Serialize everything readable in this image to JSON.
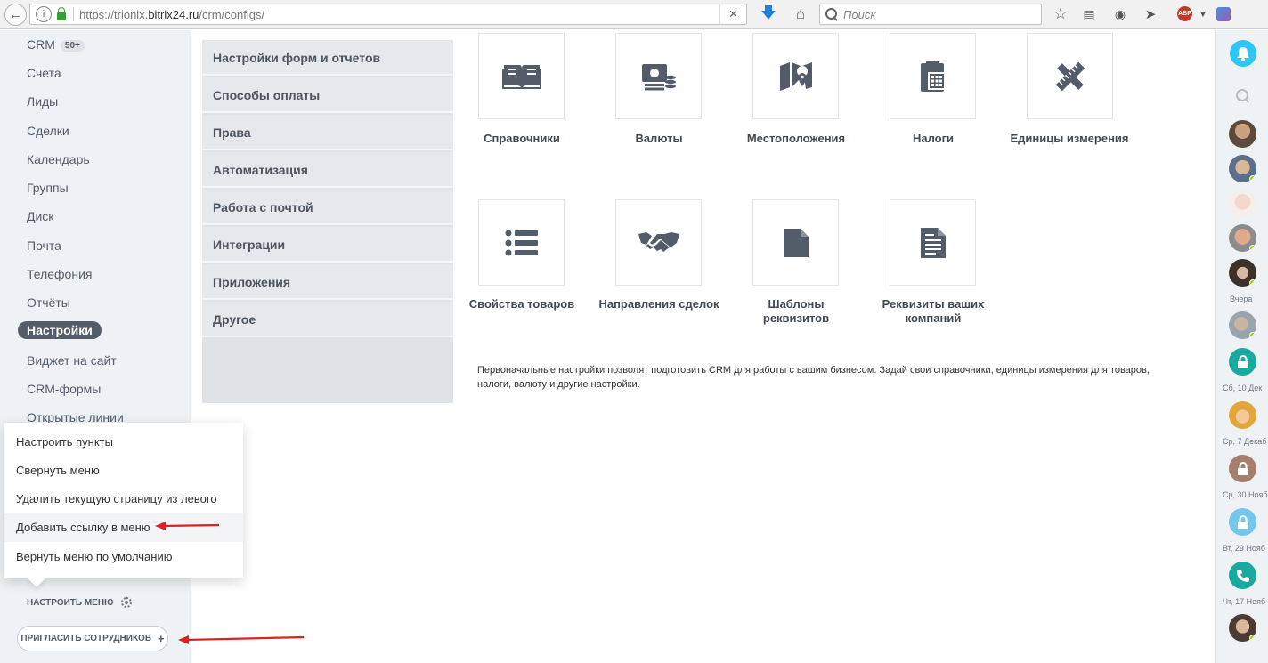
{
  "browser": {
    "url_host": "https://trionix.",
    "url_domain": "bitrix24.ru",
    "url_path": "/crm/configs/",
    "search_placeholder": "Поиск",
    "abp_label": "ABP"
  },
  "left_menu": {
    "items": [
      {
        "label": "CRM",
        "badge": "50+"
      },
      {
        "label": "Счета"
      },
      {
        "label": "Лиды"
      },
      {
        "label": "Сделки"
      },
      {
        "label": "Календарь"
      },
      {
        "label": "Группы"
      },
      {
        "label": "Диск"
      },
      {
        "label": "Почта"
      },
      {
        "label": "Телефония"
      },
      {
        "label": "Отчёты"
      },
      {
        "label": "Настройки",
        "active": true
      },
      {
        "label": "Виджет на сайт"
      },
      {
        "label": "CRM-формы"
      },
      {
        "label": "Открытые линии"
      }
    ],
    "configure_menu_label": "НАСТРОИТЬ МЕНЮ",
    "invite_label": "ПРИГЛАСИТЬ СОТРУДНИКОВ",
    "invite_plus": "+"
  },
  "popup": {
    "items": [
      "Настроить пункты",
      "Свернуть меню",
      "Удалить текущую страницу из левого меню",
      "Добавить ссылку в меню",
      "Вернуть меню по умолчанию"
    ]
  },
  "settings_nav": {
    "items": [
      "Настройки форм и отчетов",
      "Способы оплаты",
      "Права",
      "Автоматизация",
      "Работа с почтой",
      "Интеграции",
      "Приложения",
      "Другое"
    ]
  },
  "tiles": [
    {
      "label": "Справочники",
      "icon": "book-icon"
    },
    {
      "label": "Валюты",
      "icon": "currency-icon"
    },
    {
      "label": "Местоположения",
      "icon": "map-icon"
    },
    {
      "label": "Налоги",
      "icon": "calculator-icon"
    },
    {
      "label": "Единицы измерения",
      "icon": "ruler-pencil-icon"
    },
    {
      "label": "Свойства товаров",
      "icon": "list-icon"
    },
    {
      "label": "Направления сделок",
      "icon": "handshake-icon"
    },
    {
      "label": "Шаблоны реквизитов",
      "icon": "document-blank-icon"
    },
    {
      "label": "Реквизиты ваших компаний",
      "icon": "document-text-icon"
    }
  ],
  "description": "Первоначальные настройки позволят подготовить CRM для работы с вашим бизнесом. Задай свои справочники, единицы измерения для товаров, налоги, валюту и другие настройки.",
  "right_panel": {
    "dates": [
      "Вчера",
      "Сб, 10 Дек",
      "Ср, 7 Декаб",
      "Ср, 30 Нояб",
      "Вт, 29 Нояб",
      "Чт, 17 Нояб"
    ]
  },
  "colors": {
    "menu_bg": "#eef2f4",
    "active_item": "#535c69",
    "tile_icon": "#535c69",
    "bell": "#2fc6f6",
    "teal": "#19a99e",
    "brown": "#a67e6d",
    "light_blue": "#74c7ea",
    "online": "#9dcf00",
    "annotation_arrow": "#e02020"
  }
}
